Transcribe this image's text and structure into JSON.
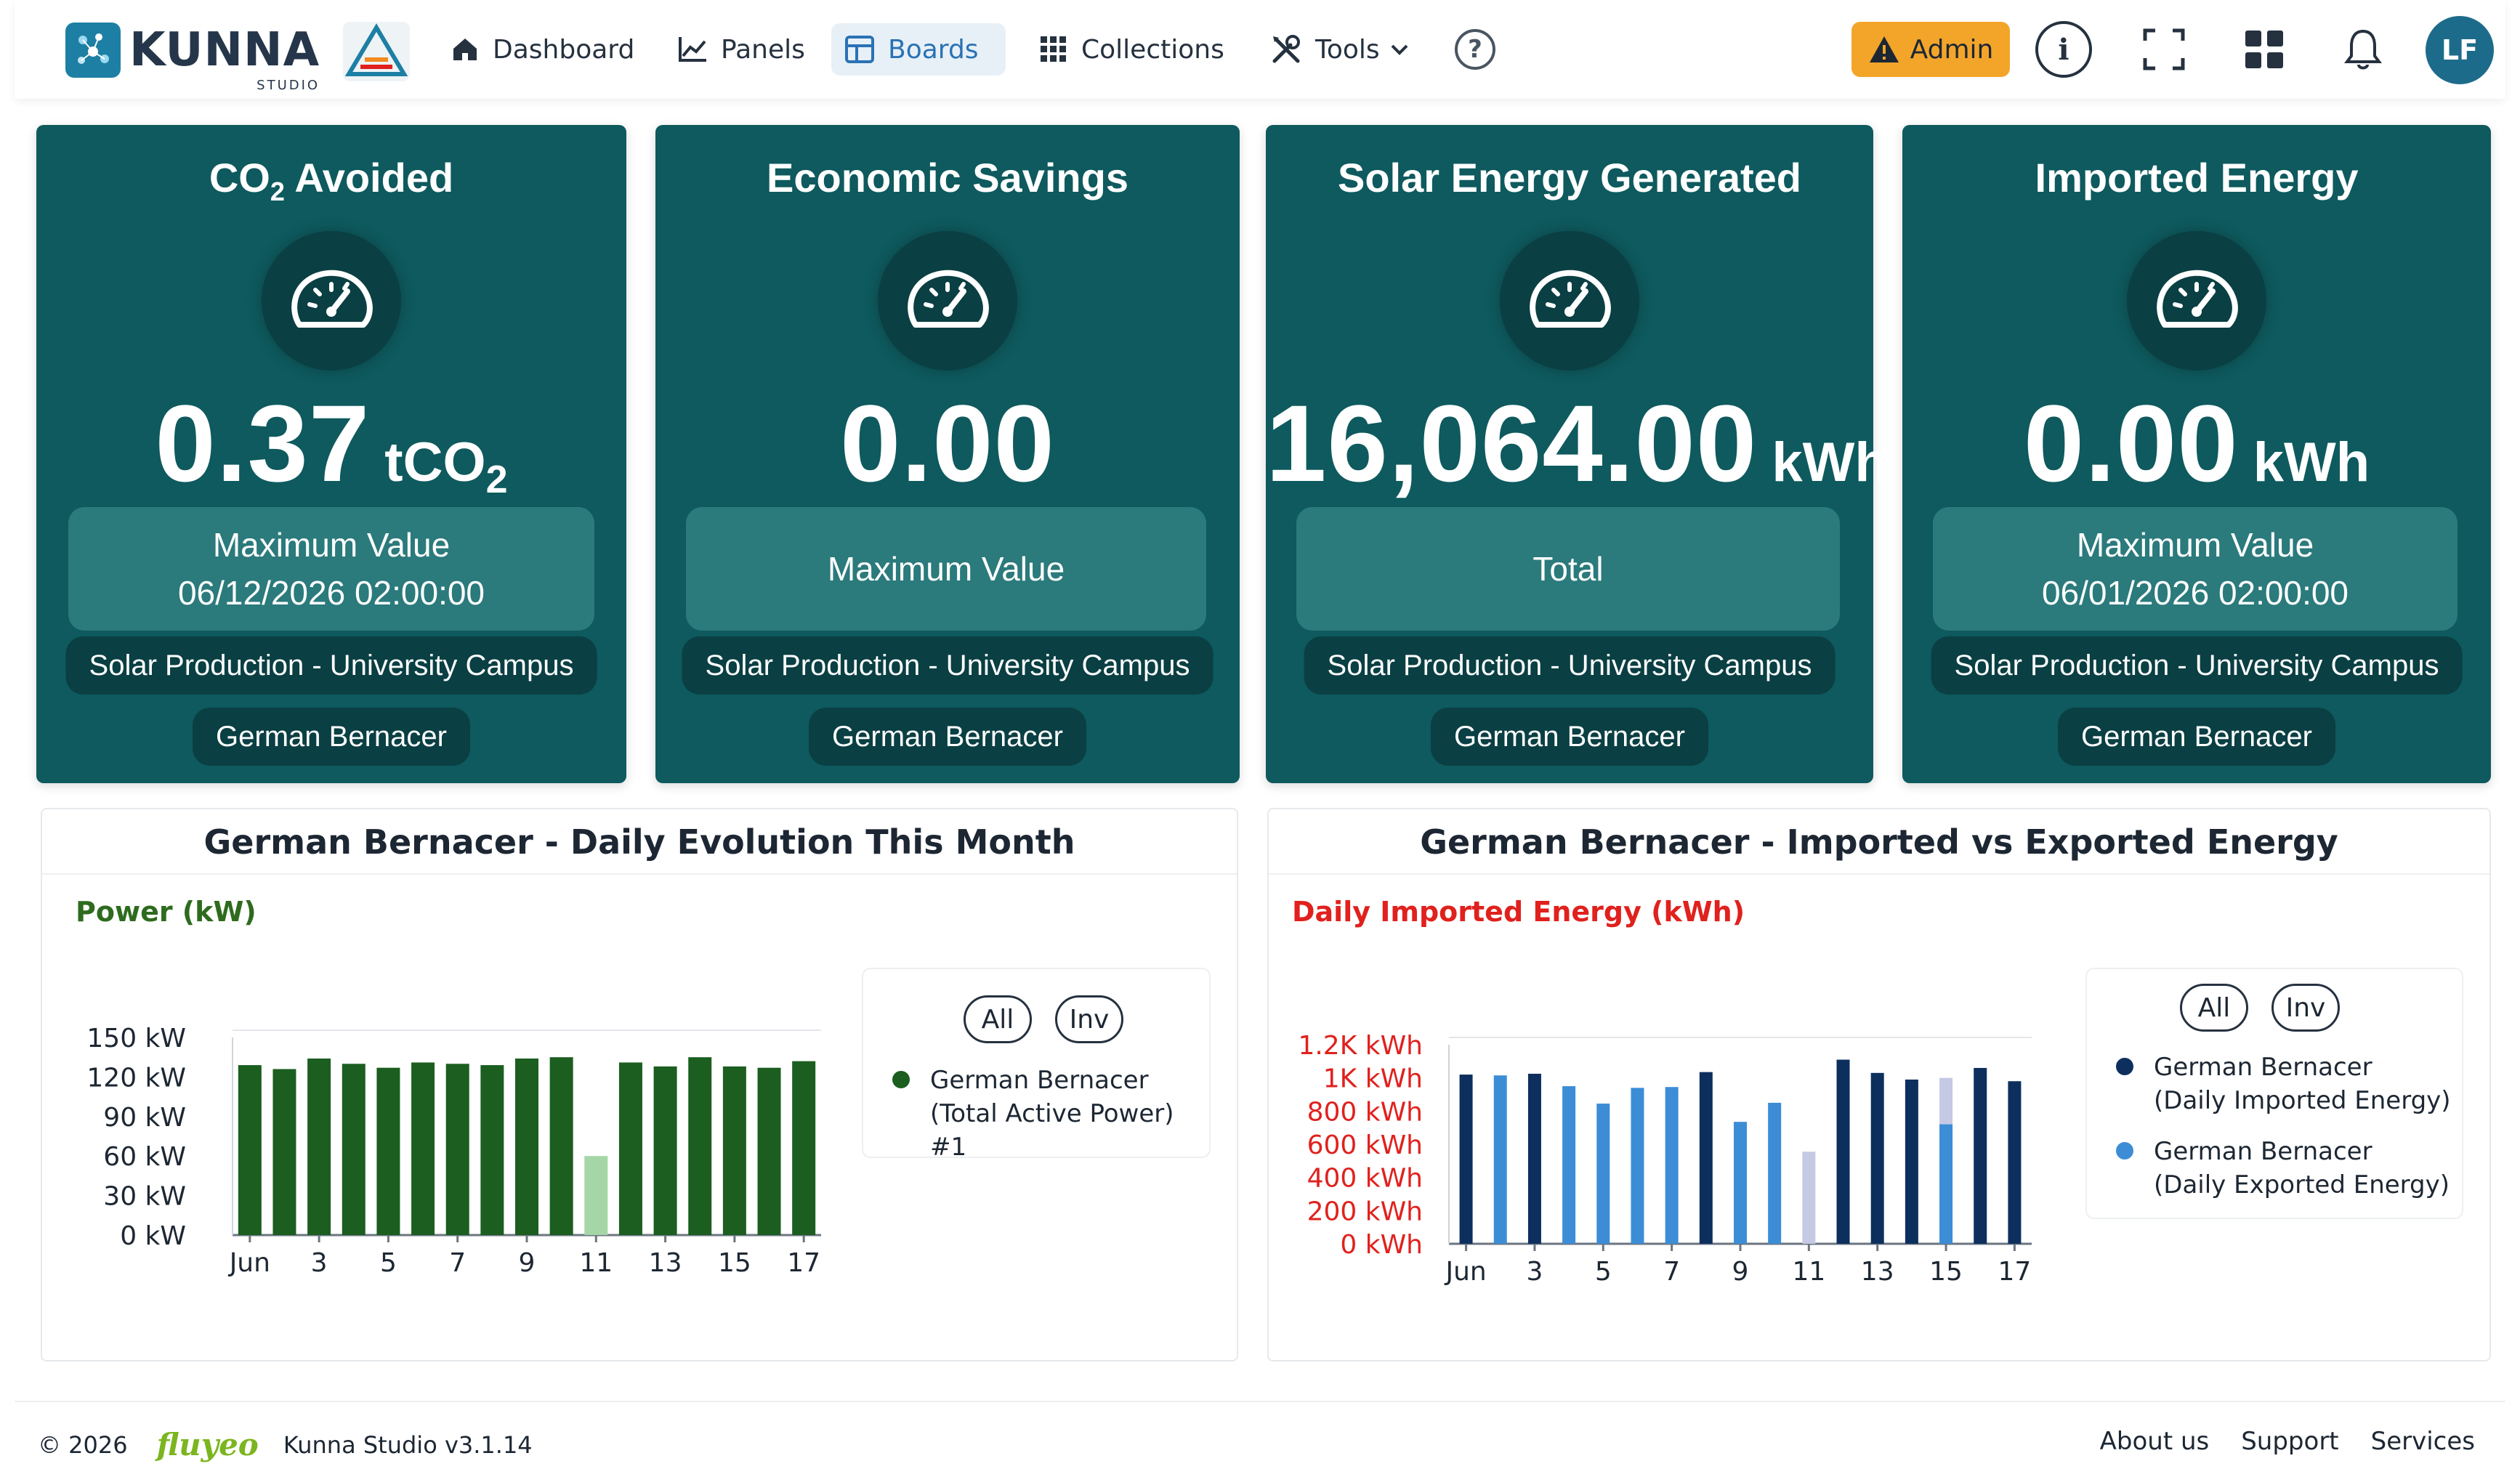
{
  "nav": {
    "logo_word": "KUNNA",
    "logo_sub": "STUDIO",
    "items": [
      {
        "label": "Dashboard",
        "icon": "home-icon"
      },
      {
        "label": "Panels",
        "icon": "line-chart-icon"
      },
      {
        "label": "Boards",
        "icon": "board-icon",
        "active": true
      },
      {
        "label": "Collections",
        "icon": "grid-icon"
      },
      {
        "label": "Tools",
        "icon": "tools-icon"
      }
    ],
    "admin_label": "Admin",
    "avatar_initials": "LF"
  },
  "cards": [
    {
      "title": "CO",
      "title_sub": "2",
      "title_suffix": " Avoided",
      "value": "0.37",
      "unit": "tCO",
      "unit_sub": "2",
      "box_line1": "Maximum Value",
      "box_line2": "06/12/2026 02:00:00",
      "site": "Solar Production - University Campus",
      "owner": "German Bernacer"
    },
    {
      "title": "Economic Savings",
      "value": "0.00",
      "unit": "",
      "box_line1": "Maximum Value",
      "box_line2": "",
      "site": "Solar Production - University Campus",
      "owner": "German Bernacer"
    },
    {
      "title": "Solar Energy Generated",
      "value": "16,064.00",
      "unit": "kWh",
      "box_line1": "Total",
      "box_line2": "",
      "site": "Solar Production - University Campus",
      "owner": "German Bernacer"
    },
    {
      "title": "Imported Energy",
      "value": "0.00",
      "unit": "kWh",
      "box_line1": "Maximum Value",
      "box_line2": "06/01/2026 02:00:00",
      "site": "Solar Production - University Campus",
      "owner": "German Bernacer"
    }
  ],
  "colors": {
    "card_bg": "#0e5a5e",
    "power_bar": "#1b5e20",
    "power_bar_highlight": "#a5d6a7",
    "imported_bar": "#0d2f5e",
    "exported_bar": "#3c8dd6",
    "pending_bar": "#c5c9e3",
    "imported_label": "#e0211d",
    "power_label": "#2e6b1e"
  },
  "charts": {
    "power": {
      "panel_title": "German Bernacer - Daily Evolution This Month",
      "axis_title": "Power (kW)",
      "legend_all": "All",
      "legend_inv": "Inv",
      "legend_line1": "German Bernacer",
      "legend_line2": "(Total Active Power) #1"
    },
    "energy": {
      "panel_title": "German Bernacer - Imported vs Exported Energy",
      "axis_title": "Daily Imported Energy (kWh)",
      "legend_all": "All",
      "legend_inv": "Inv",
      "legend1_line1": "German Bernacer",
      "legend1_line2": "(Daily Imported Energy)",
      "legend2_line1": "German Bernacer",
      "legend2_line2": "(Daily Exported Energy)"
    }
  },
  "chart_data": [
    {
      "type": "bar",
      "title": "German Bernacer - Daily Evolution This Month",
      "ylabel": "Power (kW)",
      "ylim": [
        0,
        150
      ],
      "yticks": [
        "0 kW",
        "30 kW",
        "60 kW",
        "90 kW",
        "120 kW",
        "150 kW"
      ],
      "ytick_values": [
        0,
        30,
        60,
        90,
        120,
        150
      ],
      "x": [
        1,
        2,
        3,
        4,
        5,
        6,
        7,
        8,
        9,
        10,
        11,
        12,
        13,
        14,
        15,
        16,
        17
      ],
      "xticks": [
        "Jun",
        "3",
        "5",
        "7",
        "9",
        "11",
        "13",
        "15",
        "17"
      ],
      "xtick_values": [
        1,
        3,
        5,
        7,
        9,
        11,
        13,
        15,
        17
      ],
      "series": [
        {
          "name": "German Bernacer (Total Active Power) #1",
          "values": [
            129,
            126,
            134,
            130,
            127,
            131,
            130,
            129,
            134,
            135,
            60,
            131,
            128,
            135,
            128,
            127,
            132
          ]
        }
      ],
      "highlight_index": 10,
      "legend": "right"
    },
    {
      "type": "bar",
      "title": "German Bernacer - Imported vs Exported Energy",
      "ylabel": "Daily Imported Energy (kWh)",
      "ylim": [
        0,
        1200
      ],
      "yticks": [
        "0 kWh",
        "200 kWh",
        "400 kWh",
        "600 kWh",
        "800 kWh",
        "1K kWh",
        "1.2K kWh"
      ],
      "ytick_values": [
        0,
        200,
        400,
        600,
        800,
        1000,
        1200
      ],
      "x": [
        1,
        2,
        3,
        4,
        5,
        6,
        7,
        8,
        9,
        10,
        11,
        12,
        13,
        14,
        15,
        16,
        17
      ],
      "xticks": [
        "Jun",
        "3",
        "5",
        "7",
        "9",
        "11",
        "13",
        "15",
        "17"
      ],
      "xtick_values": [
        1,
        3,
        5,
        7,
        9,
        11,
        13,
        15,
        17
      ],
      "series": [
        {
          "name": "German Bernacer (Daily Imported Energy)",
          "values": [
            1020,
            1015,
            1025,
            950,
            845,
            940,
            945,
            1035,
            735,
            850,
            555,
            1110,
            1030,
            990,
            1000,
            1060,
            980
          ]
        },
        {
          "name": "German Bernacer (Daily Exported Energy)",
          "values": [
            null,
            null,
            null,
            null,
            null,
            null,
            null,
            null,
            null,
            null,
            null,
            null,
            null,
            null,
            720,
            null,
            null
          ]
        }
      ],
      "bar_kind": [
        "imported",
        "exported",
        "imported",
        "exported",
        "exported",
        "exported",
        "exported",
        "imported",
        "exported",
        "exported",
        "pending",
        "imported",
        "imported",
        "imported",
        "pending",
        "imported",
        "imported"
      ],
      "legend": "right"
    }
  ],
  "footer": {
    "copyright": "© 2026",
    "brand": "fluyeo",
    "version": "Kunna Studio v3.1.14",
    "links": [
      "About us",
      "Support",
      "Services"
    ]
  }
}
